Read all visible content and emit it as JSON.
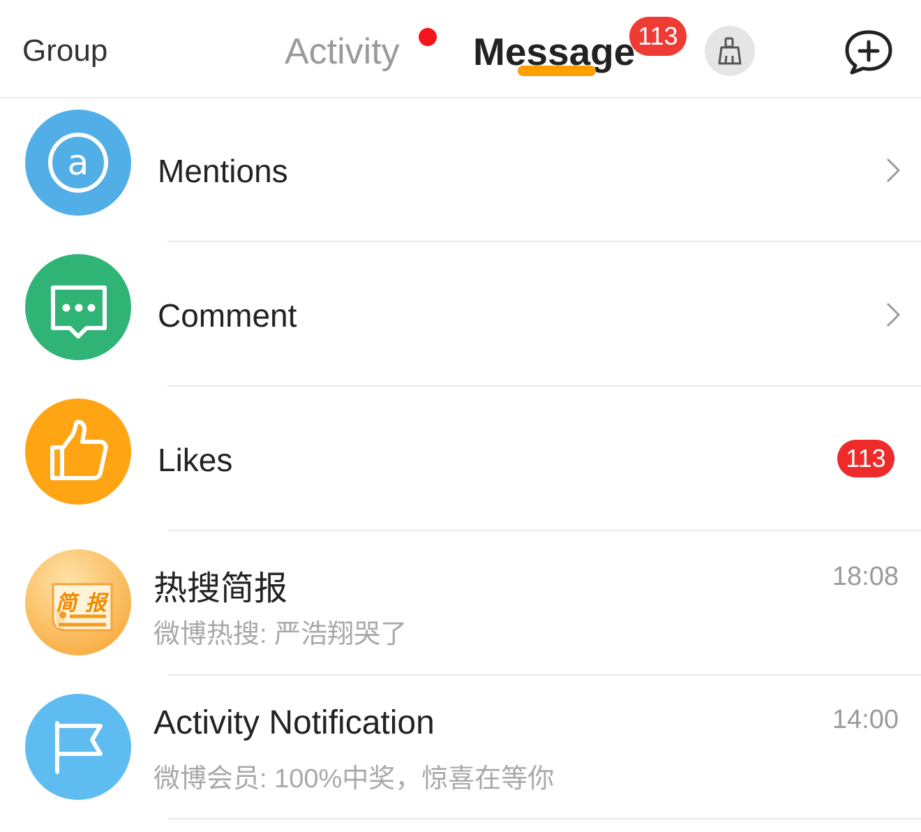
{
  "header": {
    "tab_group": "Group",
    "tab_activity": "Activity",
    "tab_message": "Message",
    "message_badge": "113",
    "accent_color": "#ff9f00",
    "badge_color": "#ee3b34",
    "clear_icon": "broom-icon",
    "compose_icon": "add-chat-icon"
  },
  "rows": [
    {
      "title": "Mentions",
      "icon": "at-icon",
      "color": "#52aee6"
    },
    {
      "title": "Comment",
      "icon": "comment-icon",
      "color": "#30b475"
    },
    {
      "title": "Likes",
      "icon": "thumbs-up-icon",
      "color": "#ffa412",
      "badge": "113"
    },
    {
      "title": "热搜简报",
      "subtitle": "微博热搜: 严浩翔哭了",
      "time": "18:08",
      "icon": "brief-icon",
      "icon_text": "简 报"
    },
    {
      "title": "Activity Notification",
      "subtitle": "微博会员: 100%中奖，惊喜在等你",
      "time": "14:00",
      "icon": "flag-icon",
      "color": "#5ebcf0"
    }
  ]
}
